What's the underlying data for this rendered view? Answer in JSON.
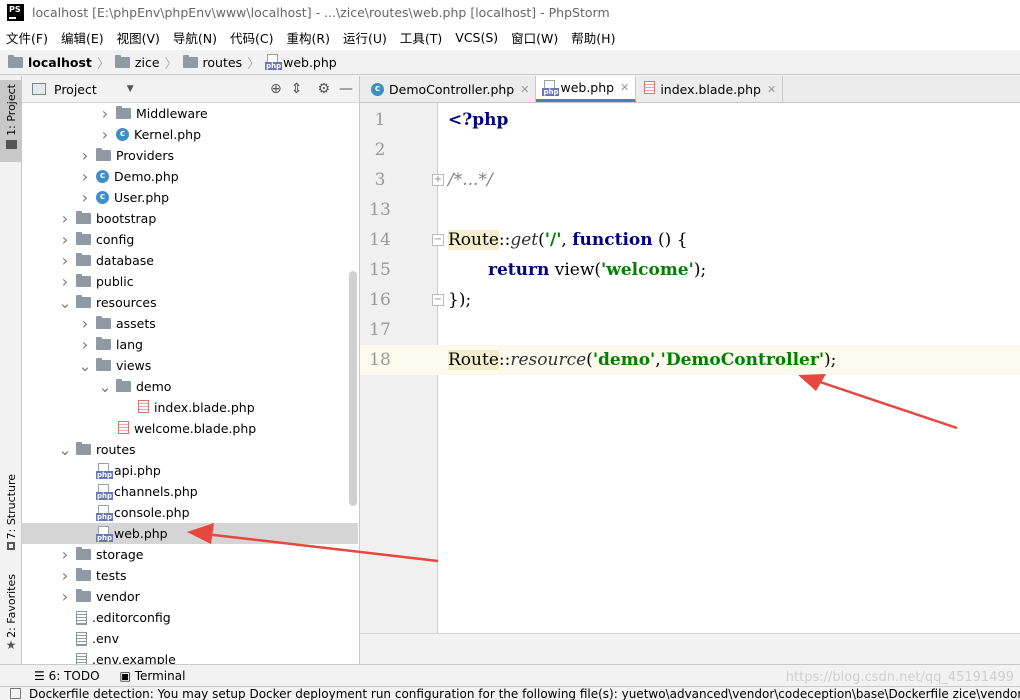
{
  "window": {
    "title": "localhost [E:\\phpEnv\\phpEnv\\www\\localhost] - ...\\zice\\routes\\web.php [localhost] - PhpStorm",
    "logo": "PS"
  },
  "menu": [
    "文件(F)",
    "编辑(E)",
    "视图(V)",
    "导航(N)",
    "代码(C)",
    "重构(R)",
    "运行(U)",
    "工具(T)",
    "VCS(S)",
    "窗口(W)",
    "帮助(H)"
  ],
  "breadcrumb": [
    "localhost",
    "zice",
    "routes",
    "web.php"
  ],
  "left_strip": {
    "project_tab": "1: Project",
    "structure_tab": "7: Structure",
    "favorites_tab": "2: Favorites"
  },
  "project_pane": {
    "title": "Project",
    "tree": [
      {
        "label": "Middleware",
        "type": "folder",
        "depth": 4,
        "arrow": "collapsed"
      },
      {
        "label": "Kernel.php",
        "type": "class",
        "depth": 4,
        "arrow": "collapsed"
      },
      {
        "label": "Providers",
        "type": "folder",
        "depth": 3,
        "arrow": "collapsed"
      },
      {
        "label": "Demo.php",
        "type": "class",
        "depth": 3,
        "arrow": "collapsed"
      },
      {
        "label": "User.php",
        "type": "class",
        "depth": 3,
        "arrow": "collapsed"
      },
      {
        "label": "bootstrap",
        "type": "folder",
        "depth": 2,
        "arrow": "collapsed"
      },
      {
        "label": "config",
        "type": "folder",
        "depth": 2,
        "arrow": "collapsed"
      },
      {
        "label": "database",
        "type": "folder",
        "depth": 2,
        "arrow": "collapsed"
      },
      {
        "label": "public",
        "type": "folder",
        "depth": 2,
        "arrow": "collapsed"
      },
      {
        "label": "resources",
        "type": "folder",
        "depth": 2,
        "arrow": "expanded"
      },
      {
        "label": "assets",
        "type": "folder",
        "depth": 3,
        "arrow": "collapsed"
      },
      {
        "label": "lang",
        "type": "folder",
        "depth": 3,
        "arrow": "collapsed"
      },
      {
        "label": "views",
        "type": "folder",
        "depth": 3,
        "arrow": "expanded"
      },
      {
        "label": "demo",
        "type": "folder",
        "depth": 4,
        "arrow": "expanded"
      },
      {
        "label": "index.blade.php",
        "type": "blade",
        "depth": 5,
        "arrow": "none"
      },
      {
        "label": "welcome.blade.php",
        "type": "blade",
        "depth": 4,
        "arrow": "none"
      },
      {
        "label": "routes",
        "type": "folder",
        "depth": 2,
        "arrow": "expanded"
      },
      {
        "label": "api.php",
        "type": "php",
        "depth": 3,
        "arrow": "none"
      },
      {
        "label": "channels.php",
        "type": "php",
        "depth": 3,
        "arrow": "none"
      },
      {
        "label": "console.php",
        "type": "php",
        "depth": 3,
        "arrow": "none"
      },
      {
        "label": "web.php",
        "type": "php",
        "depth": 3,
        "arrow": "none",
        "selected": true
      },
      {
        "label": "storage",
        "type": "folder",
        "depth": 2,
        "arrow": "collapsed"
      },
      {
        "label": "tests",
        "type": "folder",
        "depth": 2,
        "arrow": "collapsed"
      },
      {
        "label": "vendor",
        "type": "folder",
        "depth": 2,
        "arrow": "collapsed"
      },
      {
        "label": ".editorconfig",
        "type": "text",
        "depth": 2,
        "arrow": "none"
      },
      {
        "label": ".env",
        "type": "text",
        "depth": 2,
        "arrow": "none"
      },
      {
        "label": ".env.example",
        "type": "text",
        "depth": 2,
        "arrow": "none"
      }
    ]
  },
  "editor": {
    "tabs": [
      {
        "label": "DemoController.php",
        "icon": "class",
        "active": false
      },
      {
        "label": "web.php",
        "icon": "php",
        "active": true
      },
      {
        "label": "index.blade.php",
        "icon": "blade",
        "active": false
      }
    ],
    "line_numbers": [
      "1",
      "2",
      "3",
      "13",
      "14",
      "15",
      "16",
      "17",
      "18"
    ],
    "code": {
      "l1": "<?php",
      "l3": "/*...*/",
      "l14_route": "Route",
      "l14_sep": "::",
      "l14_method": "get",
      "l14_open": "(",
      "l14_str": "'/'",
      "l14_comma": ", ",
      "l14_kw": "function",
      "l14_rest": " () {",
      "l15_kw": "return",
      "l15_fn": " view(",
      "l15_str": "'welcome'",
      "l15_end": ");",
      "l16": "});",
      "l18_route": "Route",
      "l18_sep": "::",
      "l18_method": "resource",
      "l18_open": "(",
      "l18_str1": "'demo'",
      "l18_comma": ",",
      "l18_str2": "'DemoController'",
      "l18_end": ");"
    }
  },
  "toolwindows": {
    "todo": "6: TODO",
    "terminal": "Terminal"
  },
  "status": {
    "message": "Dockerfile detection: You may setup Docker deployment run configuration for the following file(s): yuetwo\\advanced\\vendor\\codeception\\base\\Dockerfile zice\\vendor\\mo"
  },
  "watermark": "https://blog.csdn.net/qq_45191499",
  "colors": {
    "annotation_arrow": "#e8473d",
    "selection": "#d5d5d5",
    "active_tab_underline": "#4083c9"
  }
}
